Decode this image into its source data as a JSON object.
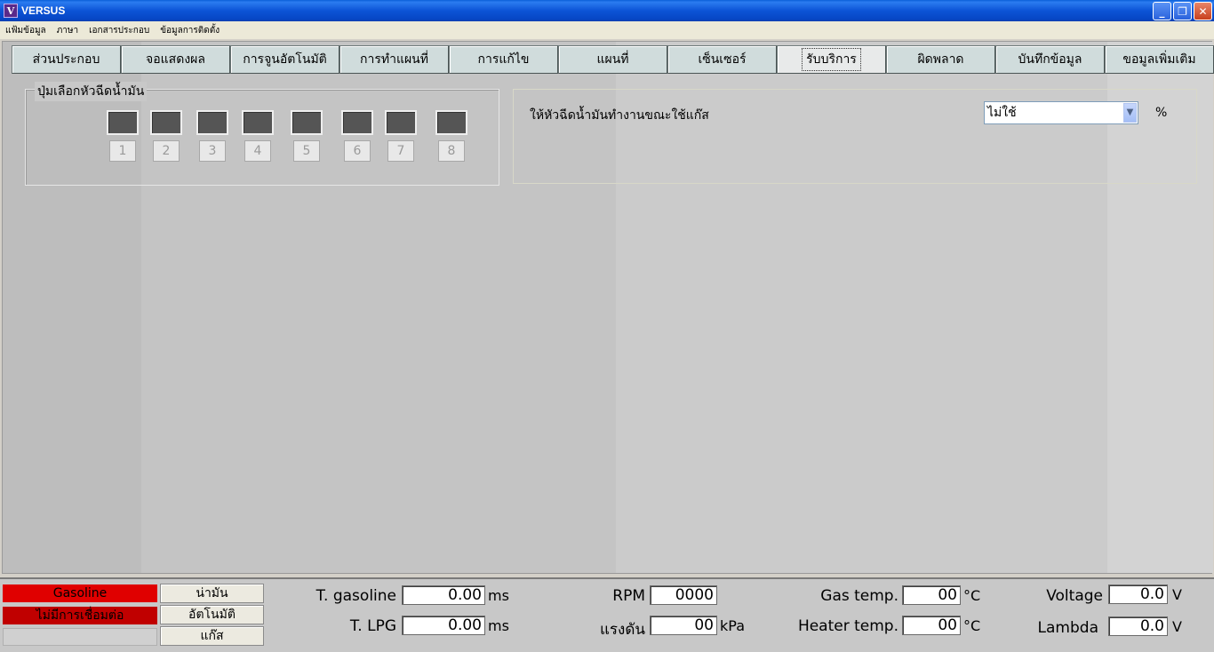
{
  "window": {
    "icon_letter": "V",
    "title": "VERSUS",
    "minimize": "_",
    "restore": "❐",
    "close": "✕"
  },
  "menu": [
    "แฟ้มข้อมูล",
    "ภาษา",
    "เอกสารประกอบ",
    "ข้อมูลการติดตั้ง"
  ],
  "tabs": [
    "ส่วนประกอบ",
    "จอแสดงผล",
    "การจูนอัตโนมัติ",
    "การทำแผนที่",
    "การแก้ไข",
    "แผนที่",
    "เซ็นเซอร์",
    "รับบริการ",
    "ผิดพลาด",
    "บันทึกข้อมูล",
    "ขอมูลเพิ่มเติม"
  ],
  "active_tab": "รับบริการ",
  "injectors": {
    "legend": "ปุ่มเลือกหัวฉีดน้ำมัน",
    "numbers": [
      "1",
      "2",
      "3",
      "4",
      "5",
      "6",
      "7",
      "8"
    ]
  },
  "service": {
    "label": "ให้หัวฉีดน้ำมันทำงานขณะใช้แก๊ส",
    "select_value": "ไม่ใช้",
    "unit": "%"
  },
  "status": {
    "fuel_mode": "Gasoline",
    "connection": "ไม่มีการเชื่อมต่อ",
    "btn_petrol": "น่ามัน",
    "btn_auto": "อัตโนมัติ",
    "btn_gas": "แก๊ส",
    "t_gasoline_label": "T. gasoline",
    "t_gasoline_value": "0.00",
    "t_gasoline_unit": "ms",
    "t_lpg_label": "T. LPG",
    "t_lpg_value": "0.00",
    "t_lpg_unit": "ms",
    "rpm_label": "RPM",
    "rpm_value": "0000",
    "pressure_label": "แรงดัน",
    "pressure_value": "00",
    "pressure_unit": "kPa",
    "gas_temp_label": "Gas temp.",
    "gas_temp_value": "00",
    "gas_temp_unit": "°C",
    "heater_temp_label": "Heater temp.",
    "heater_temp_value": "00",
    "heater_temp_unit": "°C",
    "voltage_label": "Voltage",
    "voltage_value": "0.0",
    "voltage_unit": "V",
    "lambda_label": "Lambda",
    "lambda_value": "0.0",
    "lambda_unit": "V"
  },
  "colors": {
    "fuel_mode_bg": "#e00000",
    "connection_bg": "#c00000",
    "injector_led": "#555555"
  }
}
